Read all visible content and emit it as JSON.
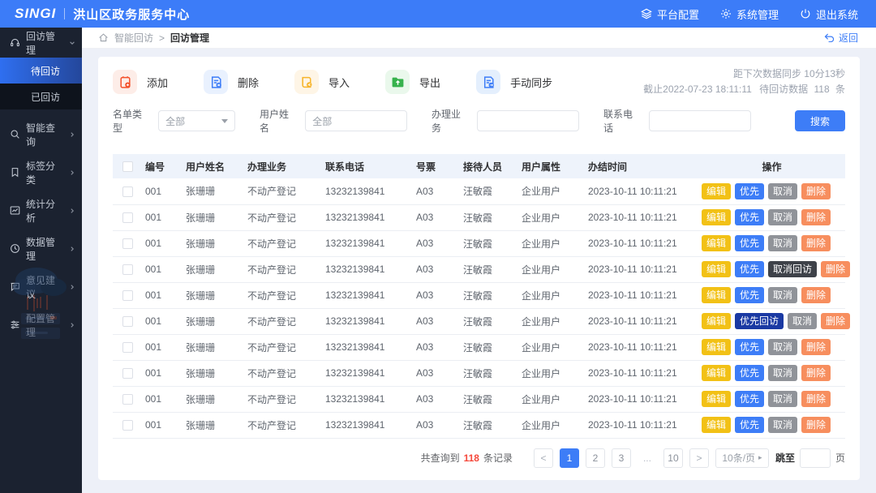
{
  "header": {
    "logo": "SINGI",
    "org": "洪山区政务服务中心",
    "menu": [
      {
        "label": "平台配置",
        "icon": "layers-icon"
      },
      {
        "label": "系统管理",
        "icon": "gear-icon"
      },
      {
        "label": "退出系统",
        "icon": "power-icon"
      }
    ]
  },
  "sidebar": {
    "items": [
      {
        "label": "回访管理",
        "icon": "headset-icon",
        "expanded": true
      },
      {
        "label": "智能查询",
        "icon": "search-icon"
      },
      {
        "label": "标签分类",
        "icon": "bookmark-icon"
      },
      {
        "label": "统计分析",
        "icon": "chart-icon"
      },
      {
        "label": "数据管理",
        "icon": "clock-icon"
      },
      {
        "label": "意见建议",
        "icon": "comment-icon"
      },
      {
        "label": "配置管理",
        "icon": "sliders-icon"
      }
    ],
    "sub_items": [
      {
        "label": "待回访",
        "active": true
      },
      {
        "label": "已回访",
        "active": false
      }
    ]
  },
  "breadcrumb": {
    "section": "智能回访",
    "separator": ">",
    "current": "回访管理",
    "back_label": "返回"
  },
  "toolbar": {
    "buttons": [
      {
        "label": "添加",
        "icon": "add-icon",
        "color": "#F4502A"
      },
      {
        "label": "删除",
        "icon": "delete-icon",
        "color": "#3D7DF7"
      },
      {
        "label": "导入",
        "icon": "import-icon",
        "color": "#F7B52C"
      },
      {
        "label": "导出",
        "icon": "export-icon",
        "color": "#37B24D"
      },
      {
        "label": "手动同步",
        "icon": "sync-icon",
        "color": "#3D7DF7"
      }
    ],
    "sync_line1": "距下次数据同步 10分13秒",
    "sync_line2_prefix": "截止2022-07-23 18:11:11",
    "sync_line2_label": "待回访数据",
    "sync_count": "118",
    "sync_unit": "条"
  },
  "filters": {
    "fields": [
      {
        "label": "名单类型",
        "value": "全部",
        "type": "select"
      },
      {
        "label": "用户姓名",
        "value": "全部",
        "type": "input"
      },
      {
        "label": "办理业务",
        "value": "",
        "type": "input"
      },
      {
        "label": "联系电话",
        "value": "",
        "type": "input"
      }
    ],
    "search_label": "搜索"
  },
  "table": {
    "columns": [
      "编号",
      "用户姓名",
      "办理业务",
      "联系电话",
      "号票",
      "接待人员",
      "用户属性",
      "办结时间",
      "操作"
    ],
    "rows": [
      {
        "id": "001",
        "name": "张珊珊",
        "business": "不动产登记",
        "phone": "13232139841",
        "ticket": "A03",
        "receptionist": "汪敏霞",
        "user_type": "企业用户",
        "finish_time": "2023-10-11 10:11:21",
        "actions": [
          {
            "label": "编辑",
            "variant": "edit"
          },
          {
            "label": "优先",
            "variant": "priority"
          },
          {
            "label": "取消",
            "variant": "cancel"
          },
          {
            "label": "删除",
            "variant": "delete"
          }
        ]
      },
      {
        "id": "001",
        "name": "张珊珊",
        "business": "不动产登记",
        "phone": "13232139841",
        "ticket": "A03",
        "receptionist": "汪敏霞",
        "user_type": "企业用户",
        "finish_time": "2023-10-11 10:11:21",
        "actions": [
          {
            "label": "编辑",
            "variant": "edit"
          },
          {
            "label": "优先",
            "variant": "priority"
          },
          {
            "label": "取消",
            "variant": "cancel"
          },
          {
            "label": "删除",
            "variant": "delete"
          }
        ]
      },
      {
        "id": "001",
        "name": "张珊珊",
        "business": "不动产登记",
        "phone": "13232139841",
        "ticket": "A03",
        "receptionist": "汪敏霞",
        "user_type": "企业用户",
        "finish_time": "2023-10-11 10:11:21",
        "actions": [
          {
            "label": "编辑",
            "variant": "edit"
          },
          {
            "label": "优先",
            "variant": "priority"
          },
          {
            "label": "取消",
            "variant": "cancel"
          },
          {
            "label": "删除",
            "variant": "delete"
          }
        ]
      },
      {
        "id": "001",
        "name": "张珊珊",
        "business": "不动产登记",
        "phone": "13232139841",
        "ticket": "A03",
        "receptionist": "汪敏霞",
        "user_type": "企业用户",
        "finish_time": "2023-10-11 10:11:21",
        "actions": [
          {
            "label": "编辑",
            "variant": "edit"
          },
          {
            "label": "优先",
            "variant": "priority"
          },
          {
            "label": "取消回访",
            "variant": "cancel-dark"
          },
          {
            "label": "删除",
            "variant": "delete"
          }
        ]
      },
      {
        "id": "001",
        "name": "张珊珊",
        "business": "不动产登记",
        "phone": "13232139841",
        "ticket": "A03",
        "receptionist": "汪敏霞",
        "user_type": "企业用户",
        "finish_time": "2023-10-11 10:11:21",
        "actions": [
          {
            "label": "编辑",
            "variant": "edit"
          },
          {
            "label": "优先",
            "variant": "priority"
          },
          {
            "label": "取消",
            "variant": "cancel"
          },
          {
            "label": "删除",
            "variant": "delete"
          }
        ]
      },
      {
        "id": "001",
        "name": "张珊珊",
        "business": "不动产登记",
        "phone": "13232139841",
        "ticket": "A03",
        "receptionist": "汪敏霞",
        "user_type": "企业用户",
        "finish_time": "2023-10-11 10:11:21",
        "actions": [
          {
            "label": "编辑",
            "variant": "edit"
          },
          {
            "label": "优先回访",
            "variant": "priority-dark"
          },
          {
            "label": "取消",
            "variant": "cancel"
          },
          {
            "label": "删除",
            "variant": "delete"
          }
        ]
      },
      {
        "id": "001",
        "name": "张珊珊",
        "business": "不动产登记",
        "phone": "13232139841",
        "ticket": "A03",
        "receptionist": "汪敏霞",
        "user_type": "企业用户",
        "finish_time": "2023-10-11 10:11:21",
        "actions": [
          {
            "label": "编辑",
            "variant": "edit"
          },
          {
            "label": "优先",
            "variant": "priority"
          },
          {
            "label": "取消",
            "variant": "cancel"
          },
          {
            "label": "删除",
            "variant": "delete"
          }
        ]
      },
      {
        "id": "001",
        "name": "张珊珊",
        "business": "不动产登记",
        "phone": "13232139841",
        "ticket": "A03",
        "receptionist": "汪敏霞",
        "user_type": "企业用户",
        "finish_time": "2023-10-11 10:11:21",
        "actions": [
          {
            "label": "编辑",
            "variant": "edit"
          },
          {
            "label": "优先",
            "variant": "priority"
          },
          {
            "label": "取消",
            "variant": "cancel"
          },
          {
            "label": "删除",
            "variant": "delete"
          }
        ]
      },
      {
        "id": "001",
        "name": "张珊珊",
        "business": "不动产登记",
        "phone": "13232139841",
        "ticket": "A03",
        "receptionist": "汪敏霞",
        "user_type": "企业用户",
        "finish_time": "2023-10-11 10:11:21",
        "actions": [
          {
            "label": "编辑",
            "variant": "edit"
          },
          {
            "label": "优先",
            "variant": "priority"
          },
          {
            "label": "取消",
            "variant": "cancel"
          },
          {
            "label": "删除",
            "variant": "delete"
          }
        ]
      },
      {
        "id": "001",
        "name": "张珊珊",
        "business": "不动产登记",
        "phone": "13232139841",
        "ticket": "A03",
        "receptionist": "汪敏霞",
        "user_type": "企业用户",
        "finish_time": "2023-10-11 10:11:21",
        "actions": [
          {
            "label": "编辑",
            "variant": "edit"
          },
          {
            "label": "优先",
            "variant": "priority"
          },
          {
            "label": "取消",
            "variant": "cancel"
          },
          {
            "label": "删除",
            "variant": "delete"
          }
        ]
      }
    ]
  },
  "pagination": {
    "summary_prefix": "共查询到",
    "summary_count": "118",
    "summary_suffix": "条记录",
    "prev": "<",
    "pages": [
      "1",
      "2",
      "3",
      "...",
      "10"
    ],
    "next": ">",
    "page_size": "10条/页",
    "jump_prefix": "跳至",
    "jump_suffix": "页"
  },
  "colors": {
    "header_blue": "#3C7CF8",
    "accent_blue": "#3D7DF7",
    "edit_yellow": "#F2C116",
    "cancel_gray": "#909399",
    "delete_orange": "#F78E5E",
    "count_red": "#F5483B"
  }
}
